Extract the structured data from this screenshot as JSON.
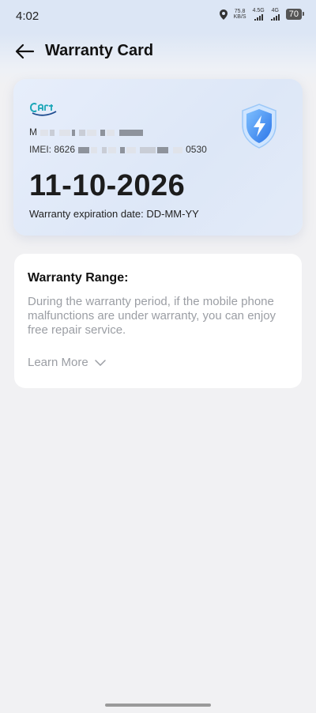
{
  "status_bar": {
    "time": "4:02",
    "net_speed_top": "75.8",
    "net_speed_bottom": "KB/S",
    "sim1_label": "4.5G",
    "sim2_label": "4G",
    "battery": "70"
  },
  "header": {
    "title": "Warranty Card"
  },
  "warranty_card": {
    "model_prefix": "M",
    "imei_prefix": "IMEI: 8626",
    "imei_suffix": "0530",
    "expiry_date": "11-10-2026",
    "expiry_label": "Warranty expiration date: DD-MM-YY",
    "shield_color": "#3b8ef0"
  },
  "warranty_range": {
    "title": "Warranty Range:",
    "description": "During the warranty period, if the mobile phone malfunctions are under warranty, you can enjoy free repair service.",
    "learn_more_label": "Learn More"
  },
  "colors": {
    "accent": "#3b8ef0",
    "card_bg": "#e2eaf8",
    "muted_text": "#9b9ea4"
  }
}
